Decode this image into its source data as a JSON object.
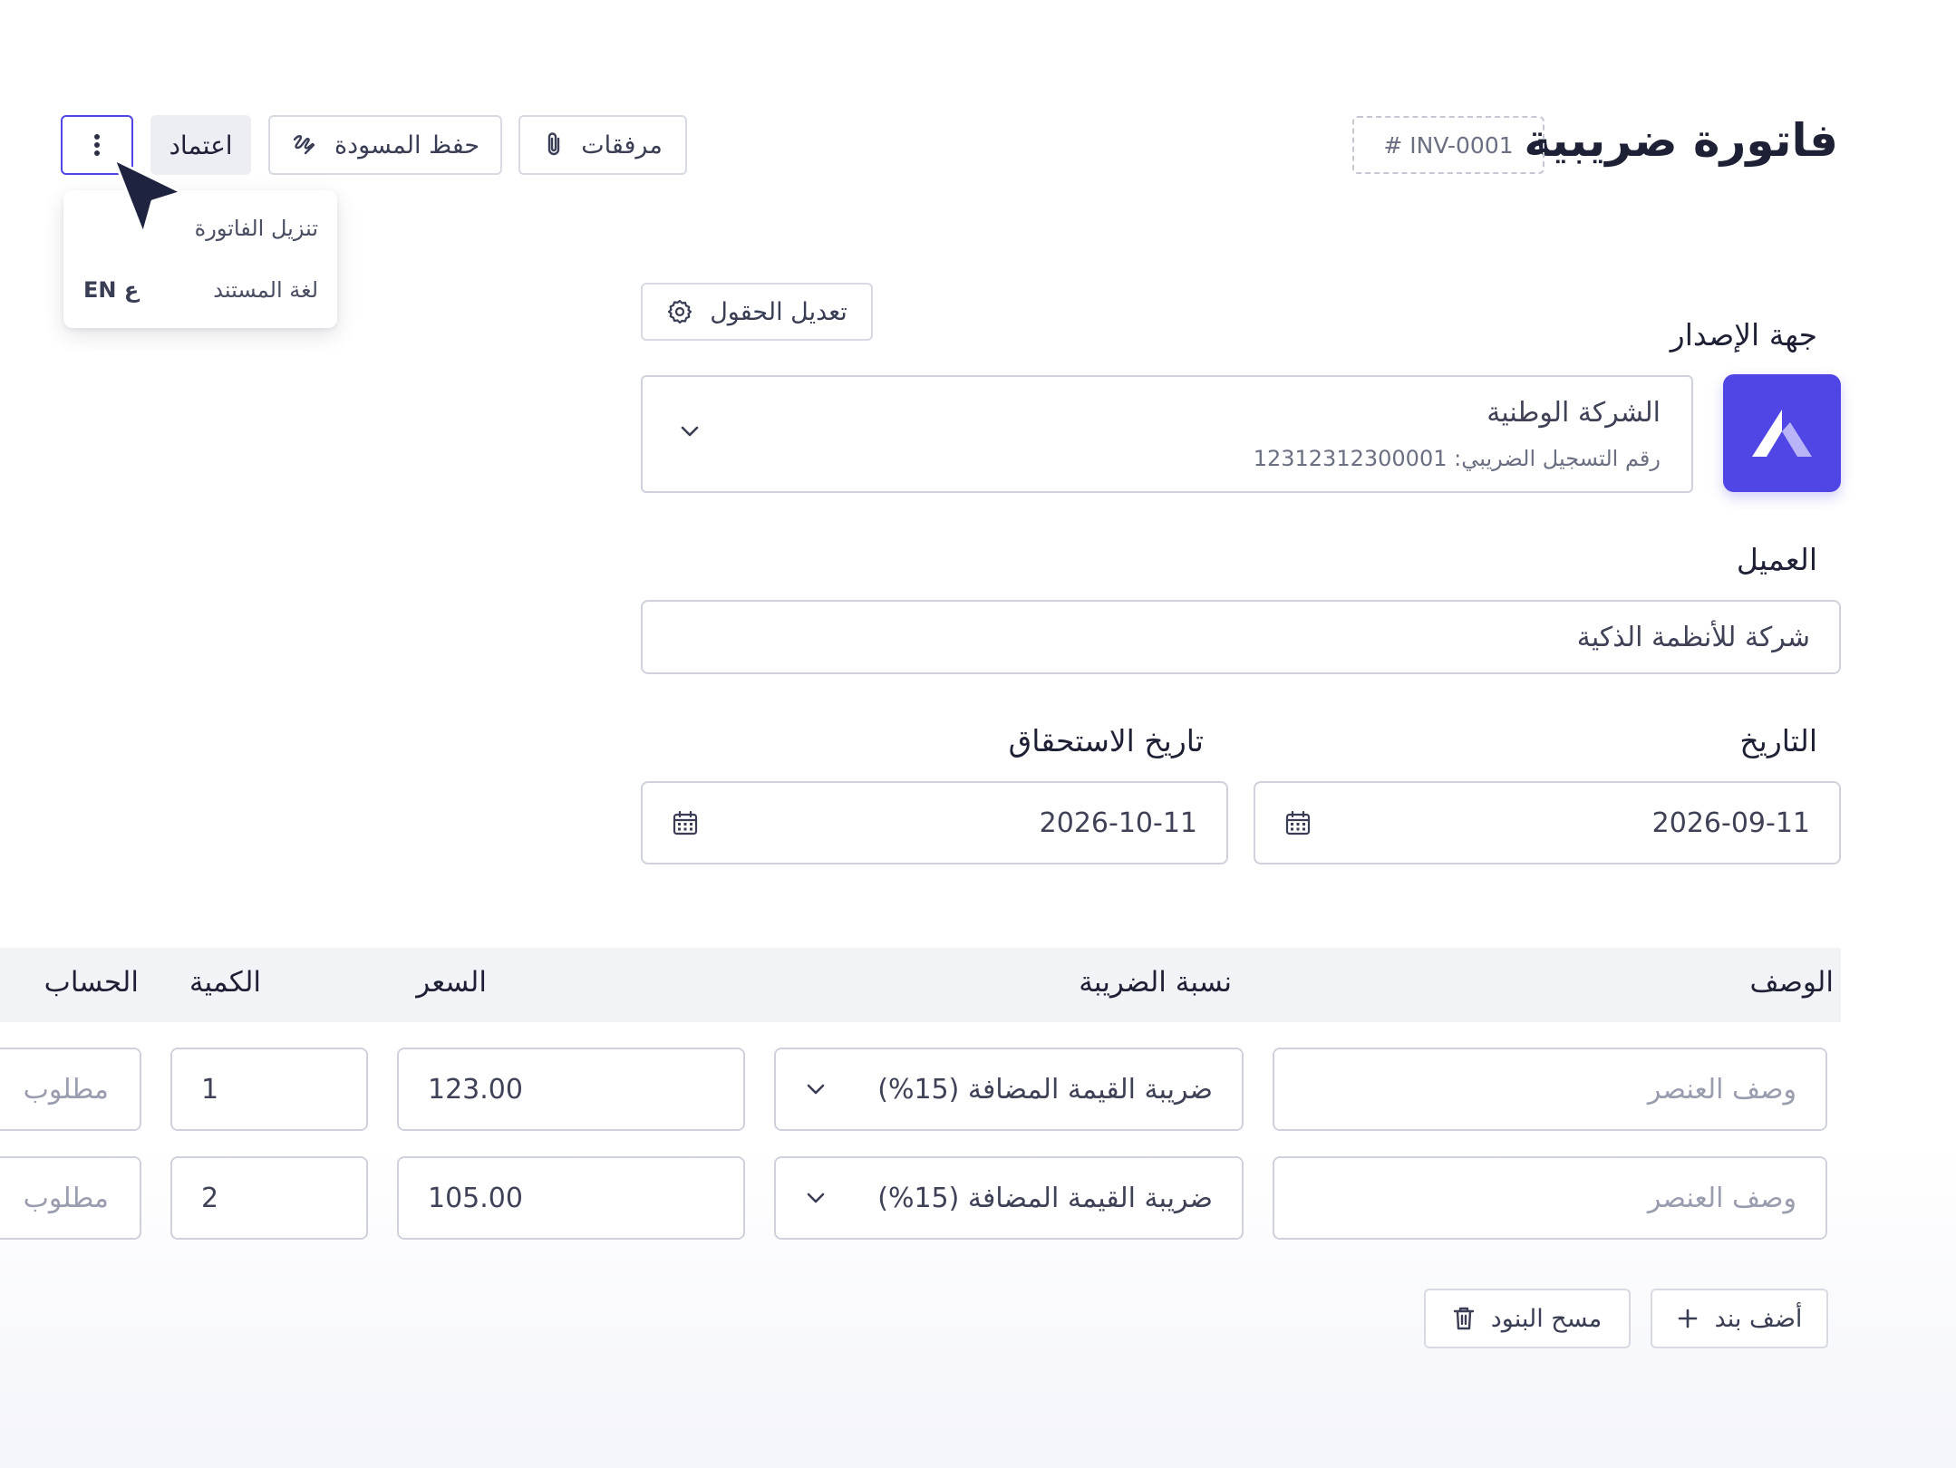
{
  "header": {
    "title": "فاتورة ضريبية",
    "invoice_number": "# INV-0001",
    "attachments_label": "مرفقات",
    "save_draft_label": "حفظ المسودة",
    "approve_label": "اعتماد"
  },
  "more_menu": {
    "items": [
      {
        "label": "تنزيل الفاتورة"
      },
      {
        "label": "لغة المستند",
        "value": "EN ع"
      }
    ]
  },
  "edit_fields_label": "تعديل الحقول",
  "issuer": {
    "label": "جهة الإصدار",
    "name": "الشركة الوطنية",
    "tax_id": "رقم التسجيل الضريبي: 12312312300001",
    "brand_color": "#4f46e5"
  },
  "customer": {
    "label": "العميل",
    "value": "شركة للأنظمة الذكية"
  },
  "dates": {
    "issue_label": "التاريخ",
    "issue_value": "2026-09-11",
    "due_label": "تاريخ الاستحقاق",
    "due_value": "2026-10-11"
  },
  "table": {
    "headers": {
      "description": "الوصف",
      "tax_rate": "نسبة الضريبة",
      "price": "السعر",
      "quantity": "الكمية",
      "account": "الحساب"
    },
    "rows": [
      {
        "description_placeholder": "وصف العنصر",
        "tax_rate": "ضريبة القيمة المضافة (15%)",
        "price": "123.00",
        "quantity": "1",
        "account_placeholder": "مطلوب"
      },
      {
        "description_placeholder": "وصف العنصر",
        "tax_rate": "ضريبة القيمة المضافة (15%)",
        "price": "105.00",
        "quantity": "2",
        "account_placeholder": "مطلوب"
      }
    ]
  },
  "actions": {
    "add_item_label": "أضف بند",
    "clear_items_label": "مسح البنود"
  }
}
